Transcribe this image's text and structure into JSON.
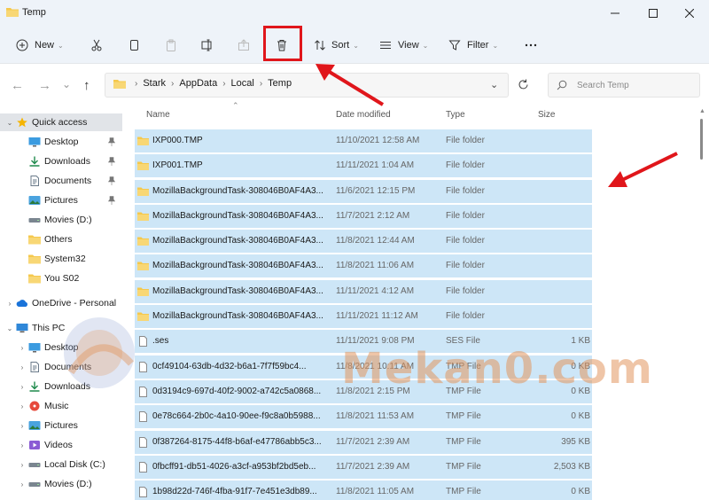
{
  "window": {
    "title": "Temp"
  },
  "commands": {
    "new": "New",
    "sort": "Sort",
    "view": "View",
    "filter": "Filter"
  },
  "address": {
    "crumbs": [
      "Stark",
      "AppData",
      "Local",
      "Temp"
    ],
    "search_placeholder": "Search Temp"
  },
  "nav": {
    "items": [
      {
        "label": "Quick access",
        "icon": "star-icon"
      },
      {
        "label": "Desktop",
        "icon": "desktop-icon"
      },
      {
        "label": "Downloads",
        "icon": "download-icon"
      },
      {
        "label": "Documents",
        "icon": "document-icon"
      },
      {
        "label": "Pictures",
        "icon": "picture-icon"
      },
      {
        "label": "Movies (D:)",
        "icon": "drive-icon"
      },
      {
        "label": "Others",
        "icon": "folder-icon"
      },
      {
        "label": "System32",
        "icon": "folder-icon"
      },
      {
        "label": "You S02",
        "icon": "folder-icon"
      },
      {
        "label": "OneDrive - Personal",
        "icon": "cloud-icon"
      },
      {
        "label": "This PC",
        "icon": "computer-icon"
      },
      {
        "label": "Desktop",
        "icon": "desktop-icon"
      },
      {
        "label": "Documents",
        "icon": "document-icon"
      },
      {
        "label": "Downloads",
        "icon": "download-icon"
      },
      {
        "label": "Music",
        "icon": "music-icon"
      },
      {
        "label": "Pictures",
        "icon": "picture-icon"
      },
      {
        "label": "Videos",
        "icon": "video-icon"
      },
      {
        "label": "Local Disk (C:)",
        "icon": "drive-icon"
      },
      {
        "label": "Movies (D:)",
        "icon": "drive-icon"
      }
    ]
  },
  "columns": {
    "name": "Name",
    "date": "Date modified",
    "type": "Type",
    "size": "Size"
  },
  "files": [
    {
      "name": "IXP000.TMP",
      "date": "11/10/2021 12:58 AM",
      "type": "File folder",
      "size": "",
      "kind": "folder"
    },
    {
      "name": "IXP001.TMP",
      "date": "11/11/2021 1:04 AM",
      "type": "File folder",
      "size": "",
      "kind": "folder"
    },
    {
      "name": "MozillaBackgroundTask-308046B0AF4A3...",
      "date": "11/6/2021 12:15 PM",
      "type": "File folder",
      "size": "",
      "kind": "folder"
    },
    {
      "name": "MozillaBackgroundTask-308046B0AF4A3...",
      "date": "11/7/2021 2:12 AM",
      "type": "File folder",
      "size": "",
      "kind": "folder"
    },
    {
      "name": "MozillaBackgroundTask-308046B0AF4A3...",
      "date": "11/8/2021 12:44 AM",
      "type": "File folder",
      "size": "",
      "kind": "folder"
    },
    {
      "name": "MozillaBackgroundTask-308046B0AF4A3...",
      "date": "11/8/2021 11:06 AM",
      "type": "File folder",
      "size": "",
      "kind": "folder"
    },
    {
      "name": "MozillaBackgroundTask-308046B0AF4A3...",
      "date": "11/11/2021 4:12 AM",
      "type": "File folder",
      "size": "",
      "kind": "folder"
    },
    {
      "name": "MozillaBackgroundTask-308046B0AF4A3...",
      "date": "11/11/2021 11:12 AM",
      "type": "File folder",
      "size": "",
      "kind": "folder"
    },
    {
      "name": ".ses",
      "date": "11/11/2021 9:08 PM",
      "type": "SES File",
      "size": "1 KB",
      "kind": "file"
    },
    {
      "name": "0cf49104-63db-4d32-b6a1-7f7f59bc4...",
      "date": "11/8/2021 10:11 AM",
      "type": "TMP File",
      "size": "0 KB",
      "kind": "file"
    },
    {
      "name": "0d3194c9-697d-40f2-9002-a742c5a0868...",
      "date": "11/8/2021 2:15 PM",
      "type": "TMP File",
      "size": "0 KB",
      "kind": "file"
    },
    {
      "name": "0e78c664-2b0c-4a10-90ee-f9c8a0b5988...",
      "date": "11/8/2021 11:53 AM",
      "type": "TMP File",
      "size": "0 KB",
      "kind": "file"
    },
    {
      "name": "0f387264-8175-44f8-b6af-e47786abb5c3...",
      "date": "11/7/2021 2:39 AM",
      "type": "TMP File",
      "size": "395 KB",
      "kind": "file"
    },
    {
      "name": "0fbcff91-db51-4026-a3cf-a953bf2bd5eb...",
      "date": "11/7/2021 2:39 AM",
      "type": "TMP File",
      "size": "2,503 KB",
      "kind": "file"
    },
    {
      "name": "1b98d22d-746f-4fba-91f7-7e451e3db89...",
      "date": "11/8/2021 11:05 AM",
      "type": "TMP File",
      "size": "0 KB",
      "kind": "file"
    }
  ],
  "watermark": "Mekan0.com",
  "colors": {
    "selection": "#cde6f7",
    "accent": "#0067c0",
    "folder": "#f5c84c",
    "annotation": "#e0161b"
  }
}
